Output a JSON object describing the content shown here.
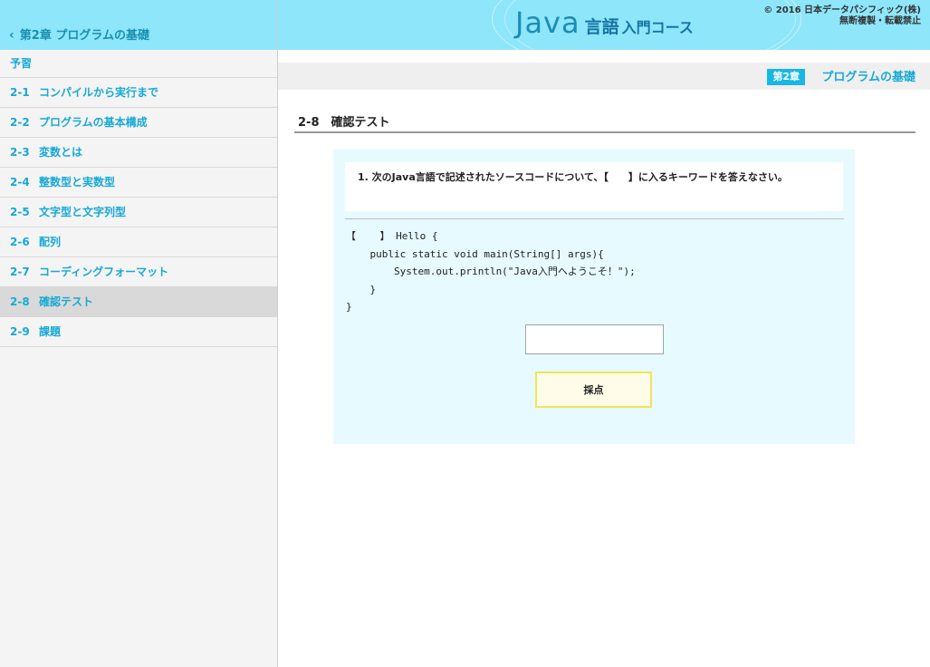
{
  "sidebar": {
    "back_label": "第2章 プログラムの基礎",
    "items": [
      {
        "num": "",
        "label": "予習"
      },
      {
        "num": "2-1",
        "label": "コンパイルから実行まで"
      },
      {
        "num": "2-2",
        "label": "プログラムの基本構成"
      },
      {
        "num": "2-3",
        "label": "変数とは"
      },
      {
        "num": "2-4",
        "label": "整数型と実数型"
      },
      {
        "num": "2-5",
        "label": "文字型と文字列型"
      },
      {
        "num": "2-6",
        "label": "配列"
      },
      {
        "num": "2-7",
        "label": "コーディングフォーマット"
      },
      {
        "num": "2-8",
        "label": "確認テスト"
      },
      {
        "num": "2-9",
        "label": "課題"
      }
    ],
    "active_index": 8
  },
  "header": {
    "logo_java": "Java",
    "logo_lang": "言語",
    "logo_course": "入門コース",
    "copyright_line1": "© 2016 日本データパシフィック(株)",
    "copyright_line2": "無断複製・転載禁止"
  },
  "chapter": {
    "badge": "第2章",
    "title": "プログラムの基礎"
  },
  "section": {
    "title": "2-8　確認テスト"
  },
  "quiz": {
    "question": "1. 次のJava言語で記述されたソースコードについて、【　　】に入るキーワードを答えなさい。",
    "code_lines": [
      "【    】 Hello {",
      "    public static void main(String[] args){",
      "        System.out.println(\"Java入門へようこそ！\");",
      "    }",
      "}"
    ],
    "answer_value": "",
    "answer_placeholder": "",
    "grade_label": "採点"
  },
  "colors": {
    "header_bg": "#8ee6fb",
    "accent": "#17a9d6",
    "quiz_bg": "#e6faff",
    "button_border": "#f6e15c"
  }
}
